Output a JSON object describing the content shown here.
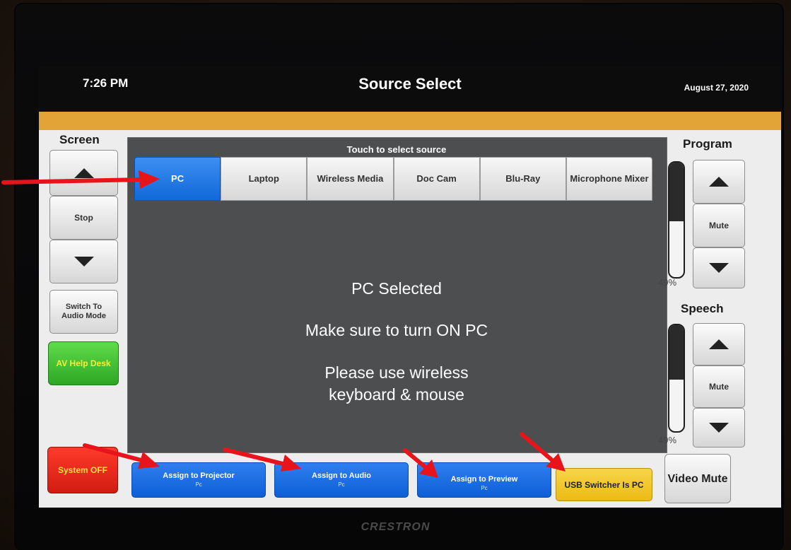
{
  "header": {
    "time": "7:26 PM",
    "title": "Source Select",
    "date": "August 27, 2020"
  },
  "screen_panel": {
    "label": "Screen",
    "stop_label": "Stop",
    "switch_label": "Switch To Audio Mode",
    "helpdesk_label": "AV Help Desk",
    "system_off_label": "System OFF"
  },
  "sources": {
    "prompt": "Touch to select source",
    "tabs": [
      {
        "label": "PC",
        "selected": true
      },
      {
        "label": "Laptop",
        "selected": false
      },
      {
        "label": "Wireless Media",
        "selected": false
      },
      {
        "label": "Doc Cam",
        "selected": false
      },
      {
        "label": "Blu-Ray",
        "selected": false
      },
      {
        "label": "Microphone Mixer",
        "selected": false
      }
    ]
  },
  "messages": {
    "line1": "PC Selected",
    "line2": "Make sure to turn ON PC",
    "line3a": "Please use wireless",
    "line3b": "keyboard & mouse"
  },
  "program": {
    "label": "Program",
    "level_percent": 49,
    "level_text": "49%",
    "mute_label": "Mute"
  },
  "speech": {
    "label": "Speech",
    "level_percent": 49,
    "level_text": "49%",
    "mute_label": "Mute"
  },
  "assign": {
    "projector": {
      "label": "Assign to Projector",
      "sub": "Pc"
    },
    "audio": {
      "label": "Assign to Audio",
      "sub": "Pc"
    },
    "preview": {
      "label": "Assign to Preview",
      "sub": "Pc"
    },
    "usb": "USB Switcher Is PC"
  },
  "video_mute_label": "Video Mute",
  "brand": "CRESTRON",
  "colors": {
    "accent_orange": "#e3a437",
    "selected_blue": "#1168d8",
    "annotation_red": "#e8141b"
  }
}
